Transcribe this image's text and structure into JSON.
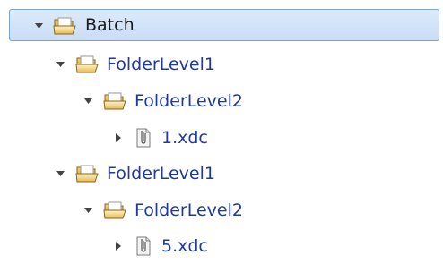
{
  "tree": {
    "nodes": [
      {
        "label": "Batch",
        "type": "folder",
        "expanded": true,
        "selected": true,
        "icon": "open-folder-icon"
      },
      {
        "label": "FolderLevel1",
        "type": "folder",
        "expanded": true,
        "selected": false,
        "icon": "open-folder-icon"
      },
      {
        "label": "FolderLevel2",
        "type": "folder",
        "expanded": true,
        "selected": false,
        "icon": "open-folder-icon"
      },
      {
        "label": "1.xdc",
        "type": "document",
        "expanded": false,
        "selected": false,
        "icon": "clip-document-icon"
      },
      {
        "label": "FolderLevel1",
        "type": "folder",
        "expanded": true,
        "selected": false,
        "icon": "open-folder-icon"
      },
      {
        "label": "FolderLevel2",
        "type": "folder",
        "expanded": true,
        "selected": false,
        "icon": "open-folder-icon"
      },
      {
        "label": "5.xdc",
        "type": "document",
        "expanded": false,
        "selected": false,
        "icon": "clip-document-icon"
      }
    ]
  },
  "colors": {
    "selection_fill": "#d3e5fa",
    "selection_border": "#7da2ce",
    "label_text": "#1e3a9a"
  }
}
